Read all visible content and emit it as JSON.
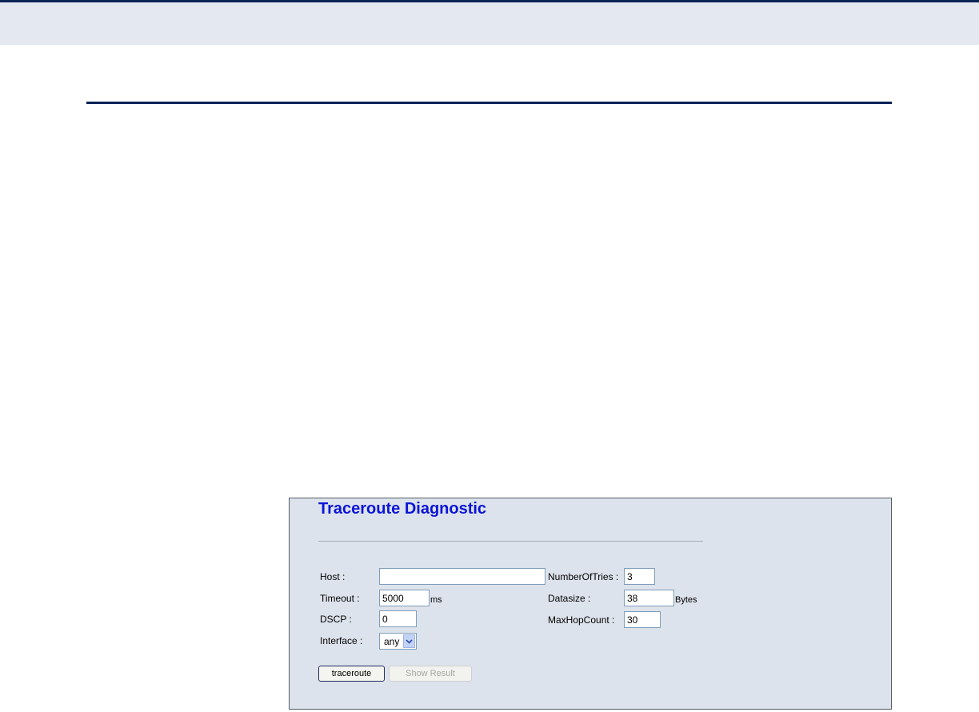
{
  "panel": {
    "title": "Traceroute Diagnostic"
  },
  "form": {
    "host": {
      "label": "Host :",
      "value": ""
    },
    "timeout": {
      "label": "Timeout :",
      "value": "5000",
      "unit": "ms"
    },
    "dscp": {
      "label": "DSCP :",
      "value": "0"
    },
    "interface": {
      "label": "Interface :",
      "selected": "any"
    },
    "number_of_tries": {
      "label": "NumberOfTries :",
      "value": "3"
    },
    "datasize": {
      "label": "Datasize :",
      "value": "38",
      "unit": "Bytes"
    },
    "max_hop_count": {
      "label": "MaxHopCount :",
      "value": "30"
    }
  },
  "buttons": {
    "traceroute": "traceroute",
    "show_result": "Show Result"
  },
  "colors": {
    "header_rule": "#0b2257",
    "title": "#0a14d8",
    "panel_background": "#dde3ec"
  }
}
